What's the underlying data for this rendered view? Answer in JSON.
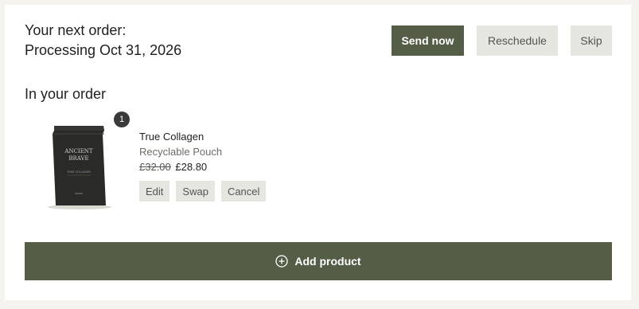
{
  "next_order": {
    "heading": "Your next order:",
    "status": "Processing Oct 31, 2026"
  },
  "actions": {
    "send_now": "Send now",
    "reschedule": "Reschedule",
    "skip": "Skip"
  },
  "order_section": {
    "title": "In your order"
  },
  "product": {
    "quantity": "1",
    "name": "True Collagen",
    "variant": "Recyclable Pouch",
    "price_original": "£32.00",
    "price_current": "£28.80",
    "pouch_brand_line1": "ANCIENT",
    "pouch_brand_line2": "BRAVE",
    "pouch_product_line": "TRUE COLLAGEN"
  },
  "item_actions": {
    "edit": "Edit",
    "swap": "Swap",
    "cancel": "Cancel"
  },
  "add_product": {
    "label": "Add product",
    "icon": "plus-circle-icon"
  },
  "colors": {
    "primary": "#545e47",
    "secondary_bg": "#e6e6e1",
    "page_bg": "#f4f3ee",
    "badge": "#3a3a3a"
  }
}
